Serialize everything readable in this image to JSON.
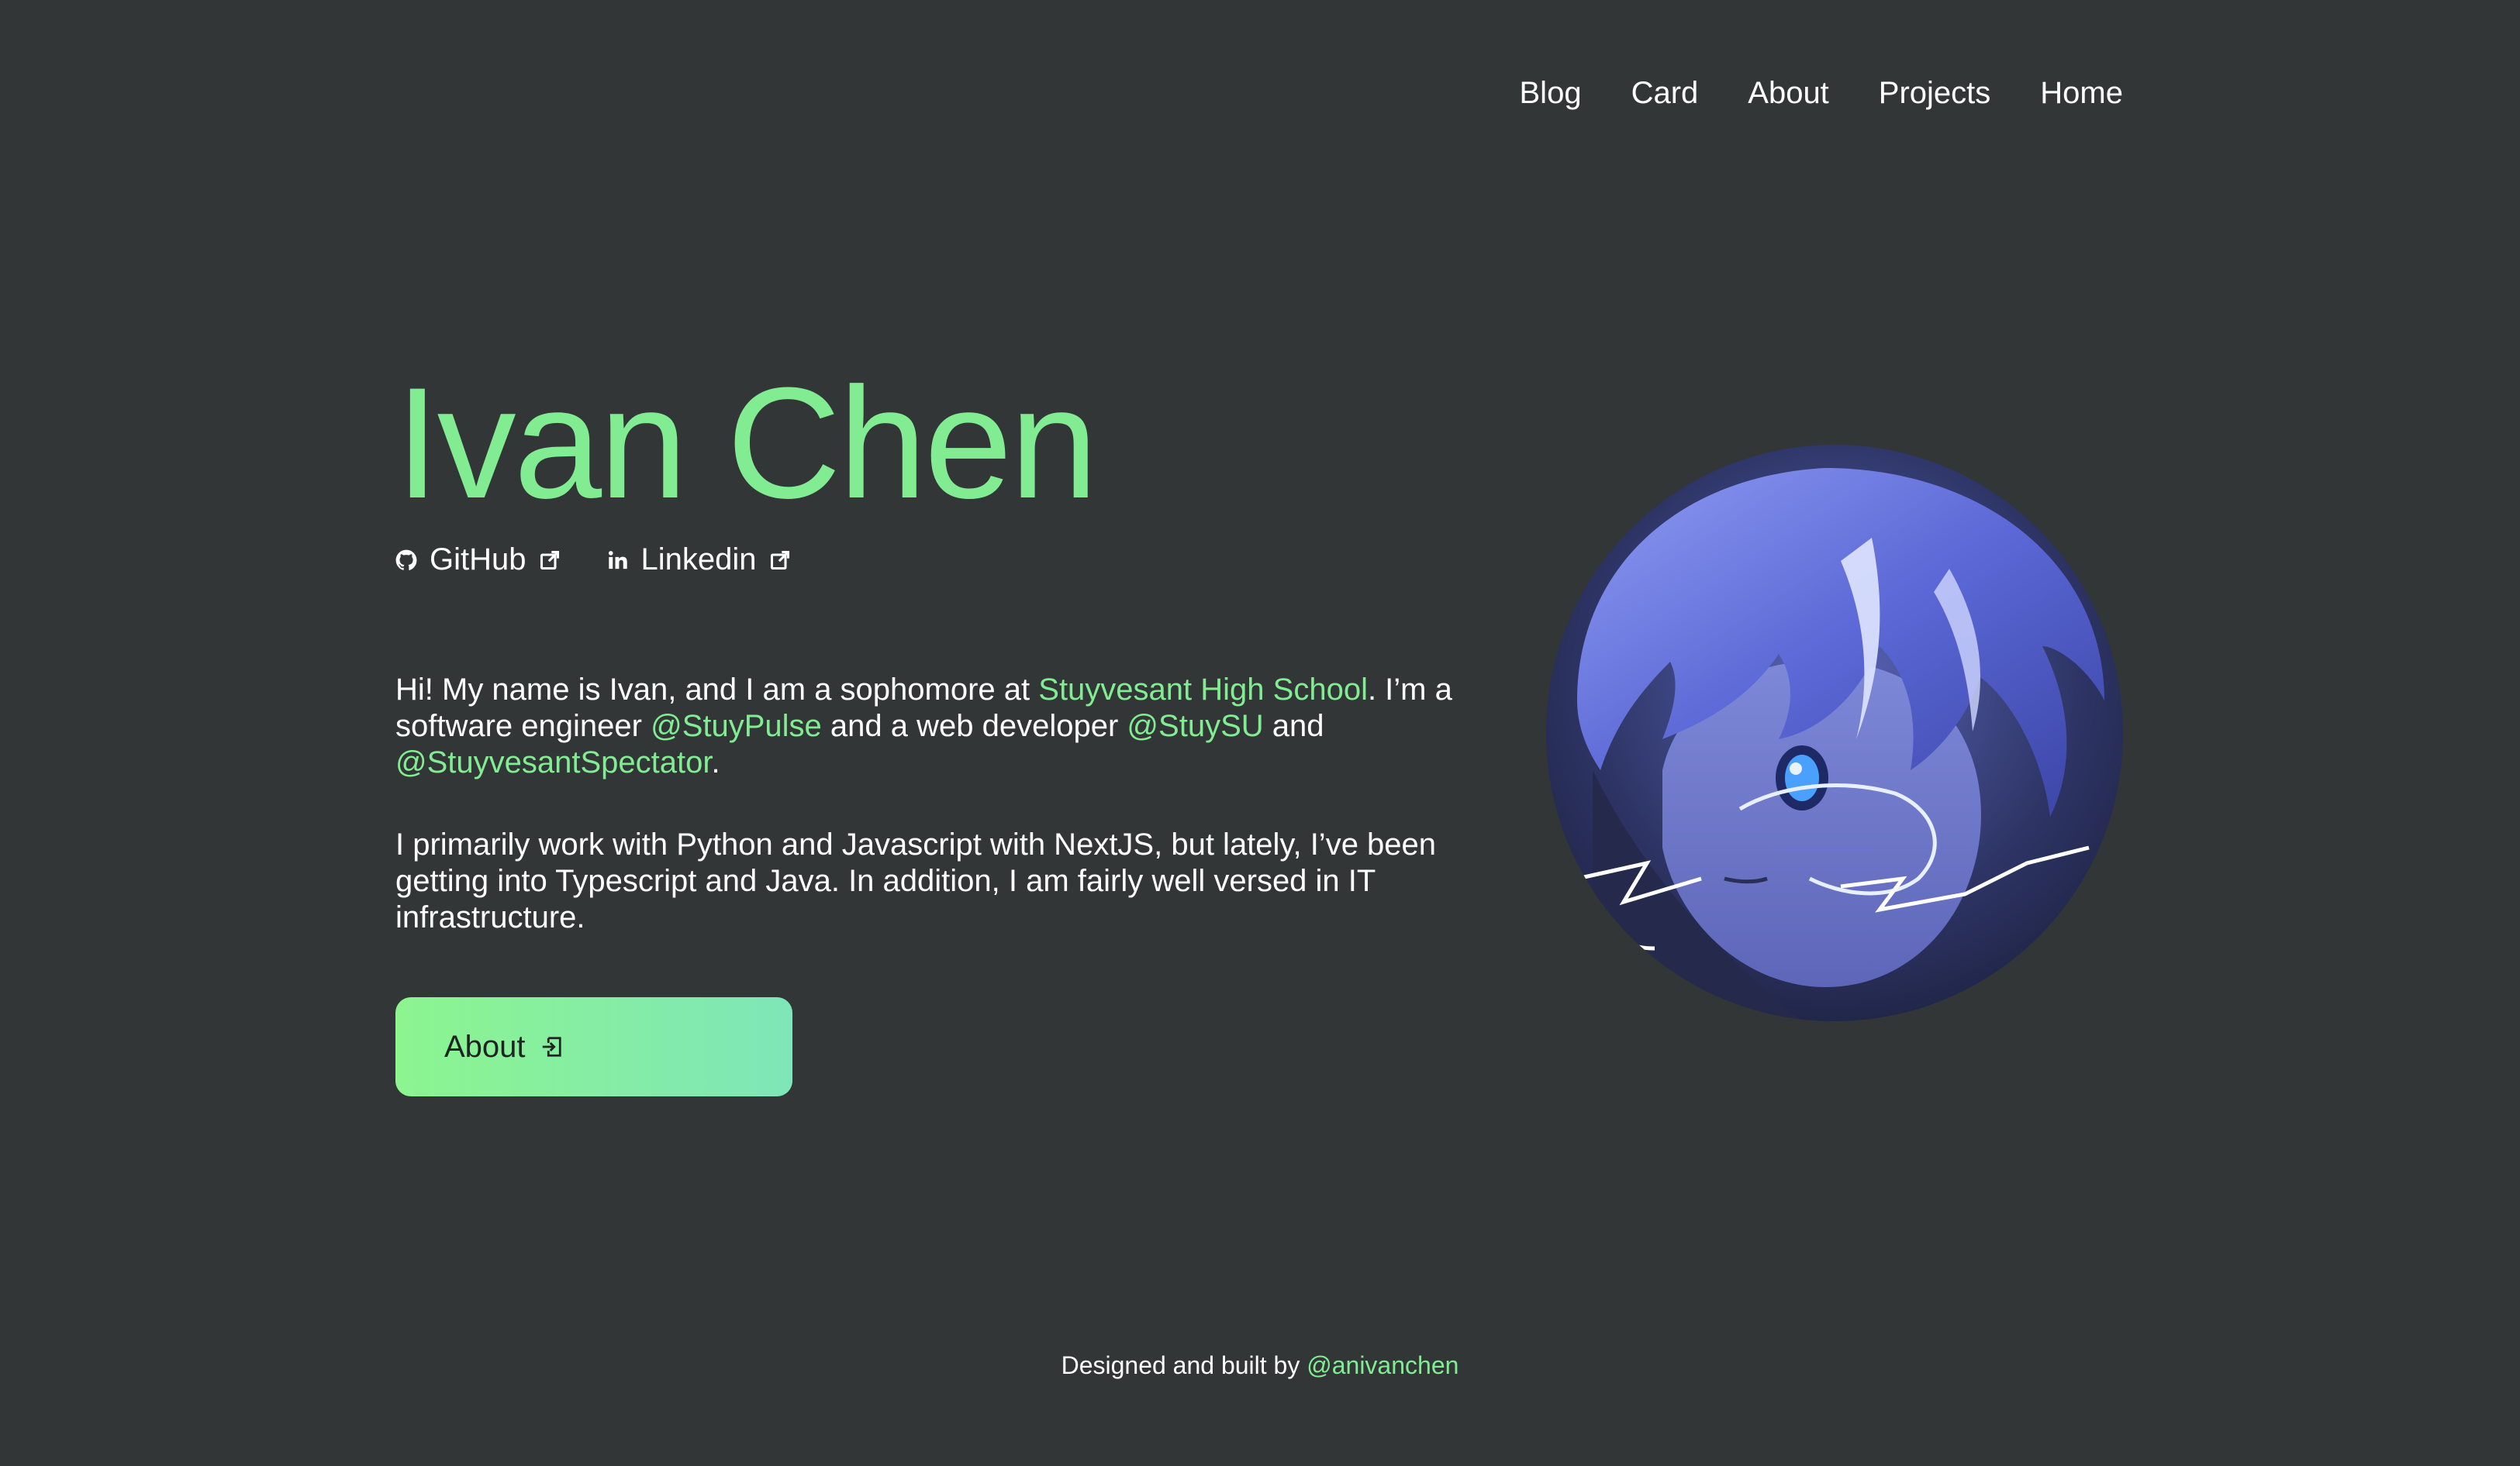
{
  "nav": {
    "items": [
      {
        "label": "Blog"
      },
      {
        "label": "Card"
      },
      {
        "label": "About"
      },
      {
        "label": "Projects"
      },
      {
        "label": "Home"
      }
    ]
  },
  "hero": {
    "name": "Ivan Chen",
    "social": [
      {
        "label": "GitHub",
        "icon": "github-icon"
      },
      {
        "label": "Linkedin",
        "icon": "linkedin-icon"
      }
    ],
    "bio": {
      "p1": {
        "t1": "Hi! My name is Ivan, and I am a sophomore at ",
        "link1": "Stuyvesant High School",
        "t2": ". I’m a software engineer ",
        "link2": "@StuyPulse",
        "t3": " and a web developer ",
        "link3": "@StuySU",
        "t4": " and ",
        "link4": "@StuyvesantSpectator",
        "t5": "."
      },
      "p2": "I primarily work with Python and Javascript with NextJS, but lately, I’ve been getting into Typescript and Java. In addition, I am fairly well versed in IT infrastructure."
    },
    "button_label": "About",
    "button_icon": "login-icon"
  },
  "avatar": {
    "icon": "anime-avatar-image"
  },
  "footer": {
    "text": "Designed and built by ",
    "link": "@anivanchen"
  },
  "colors": {
    "background": "#323637",
    "accent": "#82ec92",
    "text": "#ffffff"
  }
}
